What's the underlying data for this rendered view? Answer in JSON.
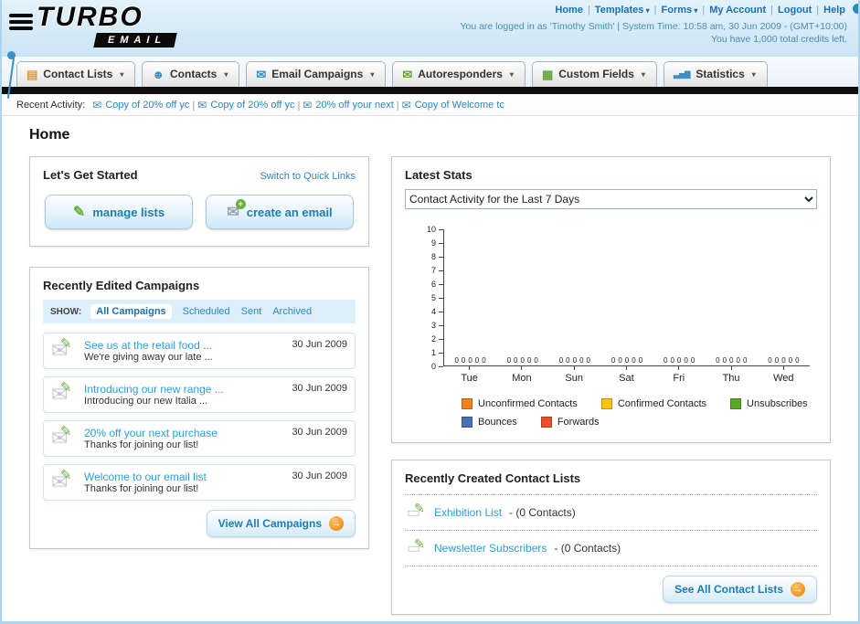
{
  "header": {
    "logo_line1": "TURBO",
    "logo_line2": "EMAIL",
    "links": [
      {
        "label": "Home",
        "dropdown": false
      },
      {
        "label": "Templates",
        "dropdown": true
      },
      {
        "label": "Forms",
        "dropdown": true
      },
      {
        "label": "My Account",
        "dropdown": false
      },
      {
        "label": "Logout",
        "dropdown": false
      },
      {
        "label": "Help",
        "dropdown": false
      }
    ],
    "login_info": "You are logged in as 'Timothy Smith' | System Time: 10:58 am, 30 Jun 2009 - (GMT+10:00)",
    "credits_info": "You have 1,000 total credits left."
  },
  "nav": {
    "items": [
      {
        "label": "Contact Lists",
        "icon": "contact-lists-icon"
      },
      {
        "label": "Contacts",
        "icon": "contacts-icon"
      },
      {
        "label": "Email Campaigns",
        "icon": "email-campaigns-icon"
      },
      {
        "label": "Autoresponders",
        "icon": "autoresponders-icon"
      },
      {
        "label": "Custom Fields",
        "icon": "custom-fields-icon"
      },
      {
        "label": "Statistics",
        "icon": "statistics-icon"
      }
    ]
  },
  "recent_activity": {
    "label": "Recent Activity:",
    "items": [
      "Copy of 20% off yc",
      "Copy of 20% off yc",
      "20% off your next",
      "Copy of Welcome tc"
    ]
  },
  "page_title": "Home",
  "get_started": {
    "title": "Let's Get Started",
    "switch_link": "Switch to Quick Links",
    "buttons": [
      {
        "label": "manage lists"
      },
      {
        "label": "create an email"
      }
    ]
  },
  "campaigns": {
    "title": "Recently Edited Campaigns",
    "show_label": "SHOW:",
    "filters": [
      "All Campaigns",
      "Scheduled",
      "Sent",
      "Archived"
    ],
    "active_filter": "All Campaigns",
    "items": [
      {
        "title": "See us at the retail food ...",
        "subtitle": "We're giving away our late ...",
        "date": "30 Jun 2009"
      },
      {
        "title": "Introducing our new range ...",
        "subtitle": "Introducing our new Italia ...",
        "date": "30 Jun 2009"
      },
      {
        "title": "20% off your next purchase",
        "subtitle": "Thanks for joining our list!",
        "date": "30 Jun 2009"
      },
      {
        "title": "Welcome to our email list",
        "subtitle": "Thanks for joining our list!",
        "date": "30 Jun 2009"
      }
    ],
    "view_all_label": "View All Campaigns"
  },
  "stats": {
    "title": "Latest Stats",
    "dropdown_value": "Contact Activity for the Last 7 Days",
    "chart_data": {
      "type": "bar",
      "title": "Contact Activity for the Last 7 Days",
      "categories": [
        "Tue",
        "Mon",
        "Sun",
        "Sat",
        "Fri",
        "Thu",
        "Wed"
      ],
      "series": [
        {
          "name": "Unconfirmed Contacts",
          "color": "#F58220",
          "values": [
            0,
            0,
            0,
            0,
            0,
            0,
            0
          ]
        },
        {
          "name": "Confirmed Contacts",
          "color": "#FFC20E",
          "values": [
            0,
            0,
            0,
            0,
            0,
            0,
            0
          ]
        },
        {
          "name": "Unsubscribes",
          "color": "#5BA829",
          "values": [
            0,
            0,
            0,
            0,
            0,
            0,
            0
          ]
        },
        {
          "name": "Bounces",
          "color": "#4A6FB5",
          "values": [
            0,
            0,
            0,
            0,
            0,
            0,
            0
          ]
        },
        {
          "name": "Forwards",
          "color": "#E8502A",
          "values": [
            0,
            0,
            0,
            0,
            0,
            0,
            0
          ]
        }
      ],
      "xlabel": "",
      "ylabel": "",
      "ylim": [
        0,
        10
      ],
      "grid": false,
      "legend_position": "bottom"
    }
  },
  "contact_lists": {
    "title": "Recently Created Contact Lists",
    "items": [
      {
        "name": "Exhibition List",
        "count": "(0 Contacts)"
      },
      {
        "name": "Newsletter Subscribers",
        "count": "(0 Contacts)"
      }
    ],
    "see_all_label": "See All Contact Lists"
  }
}
